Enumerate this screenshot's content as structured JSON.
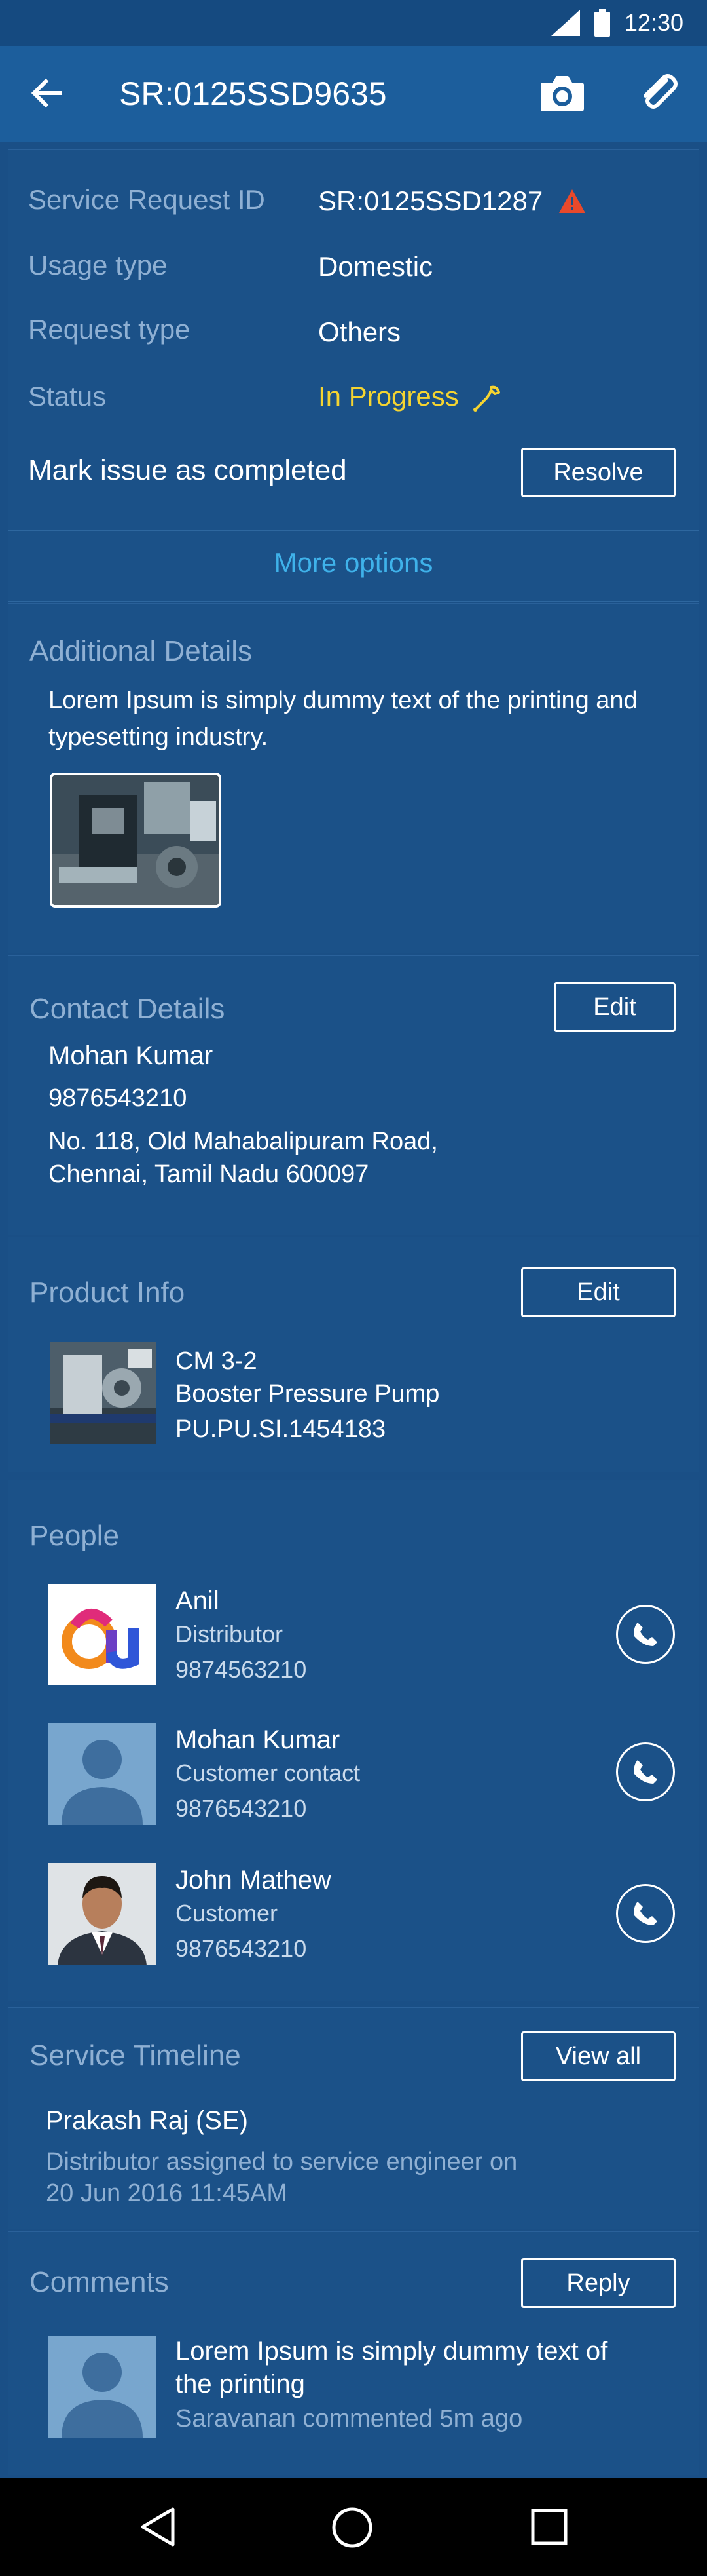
{
  "status_bar": {
    "time": "12:30",
    "signal_icon": "signal-icon",
    "battery_icon": "battery-icon"
  },
  "app_bar": {
    "title": "SR:0125SSD9635",
    "back_icon": "arrow-left-icon",
    "camera_icon": "camera-icon",
    "attach_icon": "paperclip-icon"
  },
  "summary": {
    "rows": [
      {
        "label": "Service Request ID",
        "value": "SR:0125SSD1287"
      },
      {
        "label": "Usage type",
        "value": "Domestic"
      },
      {
        "label": "Request type",
        "value": "Others"
      },
      {
        "label": "Status",
        "value": "In Progress"
      }
    ],
    "mark_complete_label": "Mark issue as completed",
    "resolve_button": "Resolve",
    "more_options": "More options",
    "status_color": "#f5d431",
    "warning_color": "#e8492b"
  },
  "additional": {
    "title": "Additional Details",
    "text": "Lorem Ipsum is simply dummy text of the printing and typesetting industry."
  },
  "contact": {
    "title": "Contact Details",
    "edit_button": "Edit",
    "name": "Mohan Kumar",
    "phone": "9876543210",
    "address_line1": "No. 118, Old Mahabalipuram Road,",
    "address_line2": "Chennai, Tamil Nadu 600097"
  },
  "product": {
    "title": "Product Info",
    "edit_button": "Edit",
    "model": "CM 3-2",
    "name": "Booster Pressure Pump",
    "serial": "PU.PU.SI.1454183"
  },
  "people": {
    "title": "People",
    "items": [
      {
        "name": "Anil",
        "role": "Distributor",
        "phone": "9874563210"
      },
      {
        "name": "Mohan Kumar",
        "role": "Customer contact",
        "phone": "9876543210"
      },
      {
        "name": "John Mathew",
        "role": "Customer",
        "phone": "9876543210"
      }
    ]
  },
  "timeline": {
    "title": "Service Timeline",
    "view_all_button": "View all",
    "actor": "Prakash Raj (SE)",
    "event_line1": "Distributor assigned to service engineer on",
    "event_line2": "20 Jun 2016 11:45AM"
  },
  "comments": {
    "title": "Comments",
    "reply_button": "Reply",
    "text_line1": "Lorem Ipsum is simply dummy text of",
    "text_line2": "the printing",
    "meta": "Saravanan commented 5m ago"
  },
  "nav": {
    "back_icon": "nav-back-icon",
    "home_icon": "nav-home-icon",
    "recents_icon": "nav-recents-icon"
  }
}
